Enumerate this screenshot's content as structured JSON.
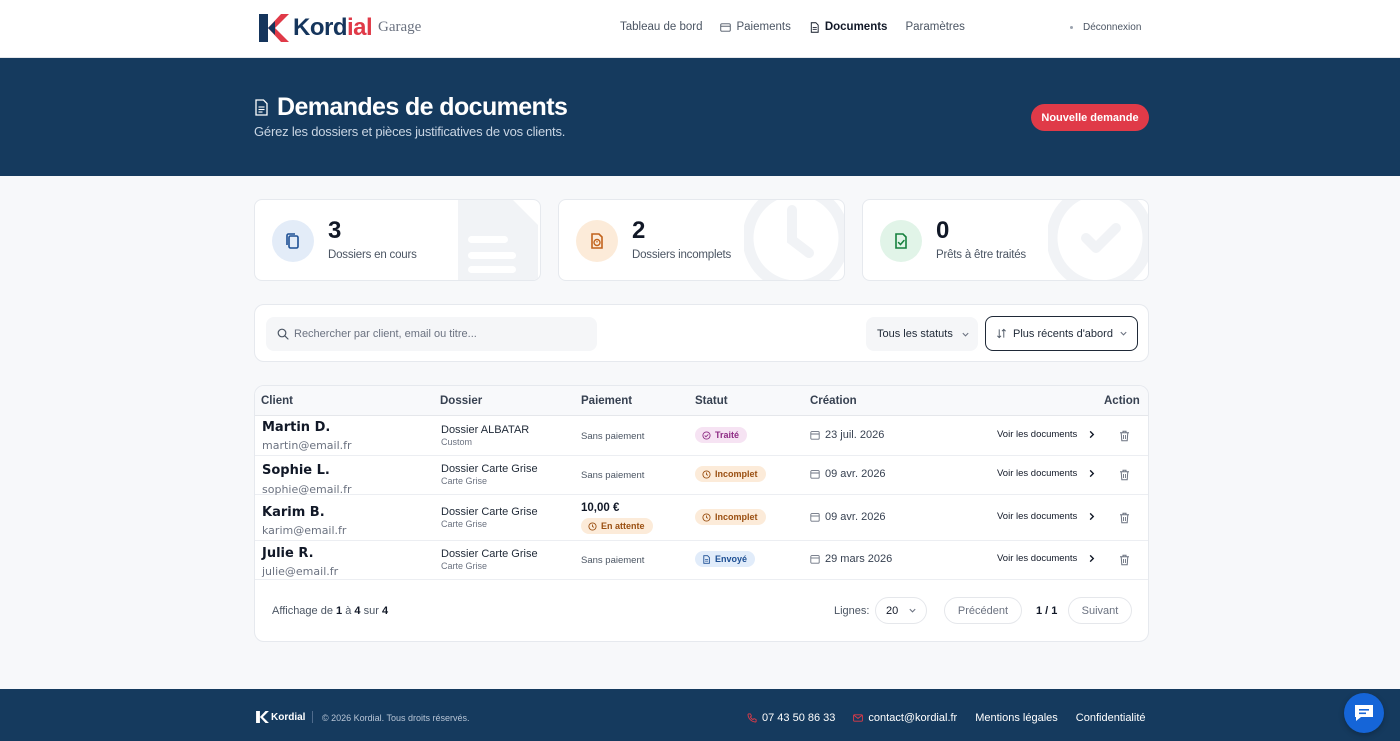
{
  "nav": {
    "brand": "Kordial",
    "brand_accent": "ial",
    "brand_main": "Kord",
    "app_name": "Garage",
    "links": [
      {
        "label": "Tableau de bord"
      },
      {
        "label": "Paiements"
      },
      {
        "label": "Documents"
      },
      {
        "label": "Paramètres"
      }
    ],
    "logout": "Déconnexion"
  },
  "hero": {
    "title": "Demandes de documents",
    "subtitle": "Gérez les dossiers et pièces justificatives de vos clients.",
    "new_button": "Nouvelle demande"
  },
  "stats": [
    {
      "value": "3",
      "label": "Dossiers en cours"
    },
    {
      "value": "2",
      "label": "Dossiers incomplets"
    },
    {
      "value": "0",
      "label": "Prêts à être traités"
    }
  ],
  "filters": {
    "search_placeholder": "Rechercher par client, email ou titre...",
    "status": "Tous les statuts",
    "sort": "Plus récents d'abord"
  },
  "table": {
    "headers": [
      "Client",
      "Dossier",
      "Paiement",
      "Statut",
      "Création",
      "Action"
    ],
    "rows": [
      {
        "name": "Martin D.",
        "email": "martin@email.fr",
        "dossier": "Dossier ALBATAR",
        "type": "Custom",
        "payment": "Sans paiement",
        "amount": "",
        "payment_status": "",
        "status": "Traité",
        "date": "23 juil. 2026",
        "action": "Voir les documents"
      },
      {
        "name": "Sophie L.",
        "email": "sophie@email.fr",
        "dossier": "Dossier Carte Grise",
        "type": "Carte Grise",
        "payment": "Sans paiement",
        "amount": "",
        "payment_status": "",
        "status": "Incomplet",
        "date": "09 avr. 2026",
        "action": "Voir les documents"
      },
      {
        "name": "Karim B.",
        "email": "karim@email.fr",
        "dossier": "Dossier Carte Grise",
        "type": "Carte Grise",
        "payment": "",
        "amount": "10,00 €",
        "payment_status": "En attente",
        "status": "Incomplet",
        "date": "09 avr. 2026",
        "action": "Voir les documents"
      },
      {
        "name": "Julie R.",
        "email": "julie@email.fr",
        "dossier": "Dossier Carte Grise",
        "type": "Carte Grise",
        "payment": "Sans paiement",
        "amount": "",
        "payment_status": "",
        "status": "Envoyé",
        "date": "29 mars 2026",
        "action": "Voir les documents"
      }
    ],
    "footer": {
      "showing_prefix": "Affichage de",
      "from": "1",
      "to_word": "à",
      "to": "4",
      "of_word": "sur",
      "total": "4",
      "lines_label": "Lignes:",
      "lines_value": "20",
      "prev": "Précédent",
      "page": "1 / 1",
      "next": "Suivant"
    }
  },
  "footer": {
    "brand": "Kordial",
    "copyright": "© 2026 Kordial. Tous droits réservés.",
    "phone": "07 43 50 86 33",
    "email": "contact@kordial.fr",
    "legal": "Mentions légales",
    "privacy": "Confidentialité"
  },
  "colors": {
    "primary_navy": "#153a5e",
    "accent_red": "#e03a48",
    "chat_blue": "#1565d8"
  }
}
